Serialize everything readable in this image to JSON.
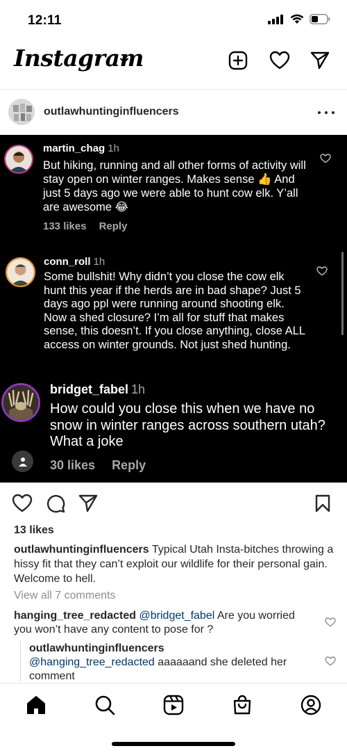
{
  "status_bar": {
    "time": "12:11"
  },
  "header": {
    "logo_text": "Instagram"
  },
  "post": {
    "username": "outlawhuntinginfluencers",
    "image_comments": [
      {
        "user": "martin_chag",
        "time": "1h",
        "text": "But hiking, running and all other forms of activity will stay open on winter ranges. Makes sense 👍 And just 5 days ago we were able to hunt cow elk. Y’all are awesome 😂",
        "likes": "133 likes",
        "reply": "Reply"
      },
      {
        "user": "conn_roll",
        "time": "1h",
        "text": "Some bullshit! Why didn’t you close the cow elk hunt this year if the herds are in bad shape? Just 5 days ago ppl were running around shooting elk. Now a shed closure? I’m all for stuff that makes sense, this doesn’t. If you close anything, close ALL access on winter grounds. Not just shed hunting."
      },
      {
        "user": "bridget_fabel",
        "time": "1h",
        "text": "How could you close this when we have no snow in winter ranges across southern utah? What a joke",
        "likes": "30 likes",
        "reply": "Reply"
      }
    ],
    "likes": "13 likes",
    "caption_user": "outlawhuntinginfluencers",
    "caption_text": " Typical Utah Insta-bitches throwing a hissy fit that they can’t exploit our wildlife for their personal gain. Welcome to hell.",
    "view_all": "View all 7 comments",
    "comments": [
      {
        "user": "hanging_tree_redacted",
        "mention": "@bridget_fabel",
        "text": "  Are you worried you won’t have any content to pose for ?"
      },
      {
        "user": "outlawhuntinginfluencers",
        "mention": "@hanging_tree_redacted",
        "text": " aaaaaand she deleted her comment"
      }
    ]
  },
  "icons": {
    "new_post": "plus-square-icon",
    "activity": "heart-icon",
    "direct": "paper-plane-icon",
    "tabs": [
      "home-icon",
      "search-icon",
      "reels-icon",
      "shop-icon",
      "profile-icon"
    ]
  }
}
